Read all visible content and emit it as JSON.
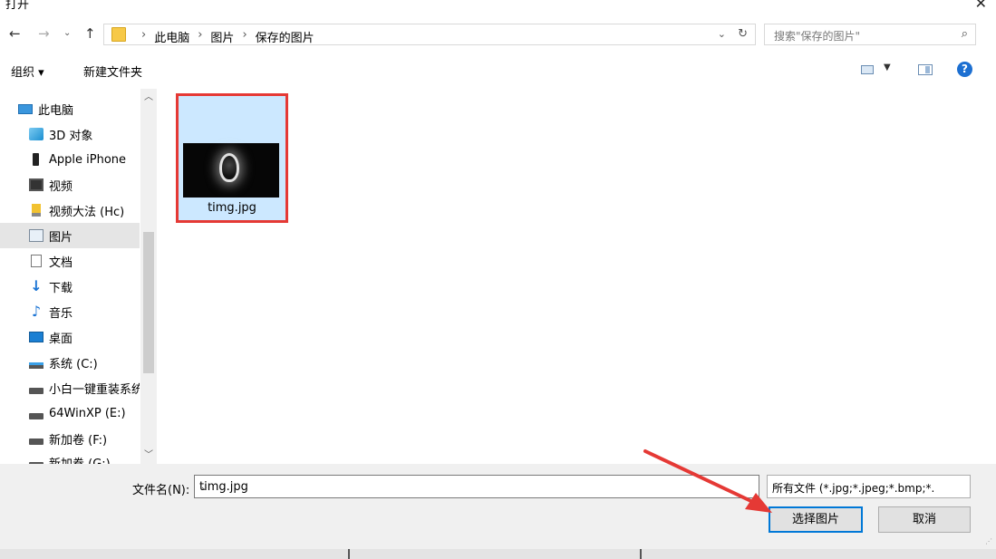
{
  "window": {
    "title": "打开",
    "close_glyph": "✕"
  },
  "address_bar": {
    "crumbs": [
      "此电脑",
      "图片",
      "保存的图片"
    ],
    "separator": "›"
  },
  "search": {
    "placeholder": "搜索\"保存的图片\""
  },
  "toolbar": {
    "organize": "组织 ▾",
    "new_folder": "新建文件夹",
    "help": "?"
  },
  "sidebar": {
    "items": [
      {
        "label": "此电脑",
        "icon": "pc-icon"
      },
      {
        "label": "3D 对象",
        "icon": "3d-objects-icon"
      },
      {
        "label": "Apple iPhone",
        "icon": "phone-icon"
      },
      {
        "label": "视频",
        "icon": "video-icon"
      },
      {
        "label": "视频大法 (Hc)",
        "icon": "usb-drive-icon"
      },
      {
        "label": "图片",
        "icon": "pictures-icon",
        "selected": true
      },
      {
        "label": "文档",
        "icon": "documents-icon"
      },
      {
        "label": "下载",
        "icon": "download-icon"
      },
      {
        "label": "音乐",
        "icon": "music-icon"
      },
      {
        "label": "桌面",
        "icon": "desktop-icon"
      },
      {
        "label": "系统 (C:)",
        "icon": "system-drive-icon"
      },
      {
        "label": "小白一键重装系统",
        "icon": "drive-icon"
      },
      {
        "label": "64WinXP  (E:)",
        "icon": "drive-icon"
      },
      {
        "label": "新加卷 (F:)",
        "icon": "drive-icon"
      },
      {
        "label": "新加卷 (G:)",
        "icon": "drive-icon"
      }
    ]
  },
  "files": [
    {
      "name": "timg.jpg",
      "selected": true
    }
  ],
  "bottom": {
    "filename_label": "文件名(N):",
    "filename_value": "timg.jpg",
    "filter_value": "所有文件 (*.jpg;*.jpeg;*.bmp;*.",
    "open_button": "选择图片",
    "cancel_button": "取消"
  },
  "colors": {
    "accent": "#0078d7",
    "selection": "#cce8ff",
    "annotation": "#e53935"
  }
}
